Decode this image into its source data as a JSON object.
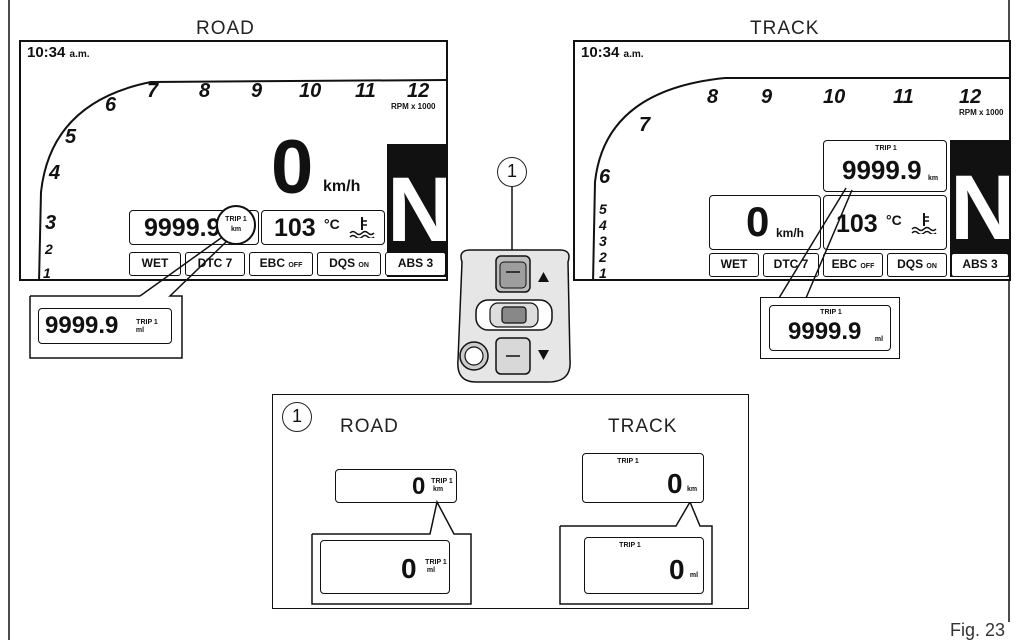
{
  "road": {
    "title": "ROAD",
    "time": "10:34",
    "time_suffix": "a.m.",
    "rpm_ticks": [
      "1",
      "2",
      "3",
      "4",
      "5",
      "6",
      "7",
      "8",
      "9",
      "10",
      "11",
      "12"
    ],
    "rpm_unit": "RPM x 1000",
    "speed": "0",
    "speed_unit": "km/h",
    "trip_value": "9999.9",
    "trip_label": "TRIP 1",
    "trip_unit": "km",
    "temp_value": "103",
    "temp_unit": "°C",
    "gear": "N",
    "buttons": [
      {
        "main": "WET",
        "sub": ""
      },
      {
        "main": "DTC 7",
        "sub": ""
      },
      {
        "main": "EBC",
        "sub": "OFF"
      },
      {
        "main": "DQS",
        "sub": "ON"
      },
      {
        "main": "ABS 3",
        "sub": ""
      }
    ],
    "callout_value": "9999.9",
    "callout_label": "TRIP 1",
    "callout_unit": "ml"
  },
  "track": {
    "title": "TRACK",
    "time": "10:34",
    "time_suffix": "a.m.",
    "rpm_ticks": [
      "1",
      "2",
      "3",
      "4",
      "5",
      "6",
      "7",
      "8",
      "9",
      "10",
      "11",
      "12"
    ],
    "rpm_unit": "RPM x 1000",
    "speed": "0",
    "speed_unit": "km/h",
    "trip_label": "TRIP 1",
    "trip_value": "9999.9",
    "trip_unit": "km",
    "temp_value": "103",
    "temp_unit": "°C",
    "gear": "N",
    "buttons": [
      {
        "main": "WET",
        "sub": ""
      },
      {
        "main": "DTC 7",
        "sub": ""
      },
      {
        "main": "EBC",
        "sub": "OFF"
      },
      {
        "main": "DQS",
        "sub": "ON"
      },
      {
        "main": "ABS 3",
        "sub": ""
      }
    ],
    "callout_label": "TRIP 1",
    "callout_value": "9999.9",
    "callout_unit": "ml"
  },
  "switch": {
    "callout_number": "1"
  },
  "detail": {
    "callout_number": "1",
    "road_title": "ROAD",
    "track_title": "TRACK",
    "road_top": {
      "value": "0",
      "label": "TRIP 1",
      "unit": "km"
    },
    "road_bottom": {
      "value": "0",
      "label": "TRIP 1",
      "unit": "ml"
    },
    "track_top": {
      "value": "0",
      "label": "TRIP 1",
      "unit": "km"
    },
    "track_bottom": {
      "value": "0",
      "label": "TRIP 1",
      "unit": "ml"
    }
  },
  "figure_label": "Fig. 23"
}
